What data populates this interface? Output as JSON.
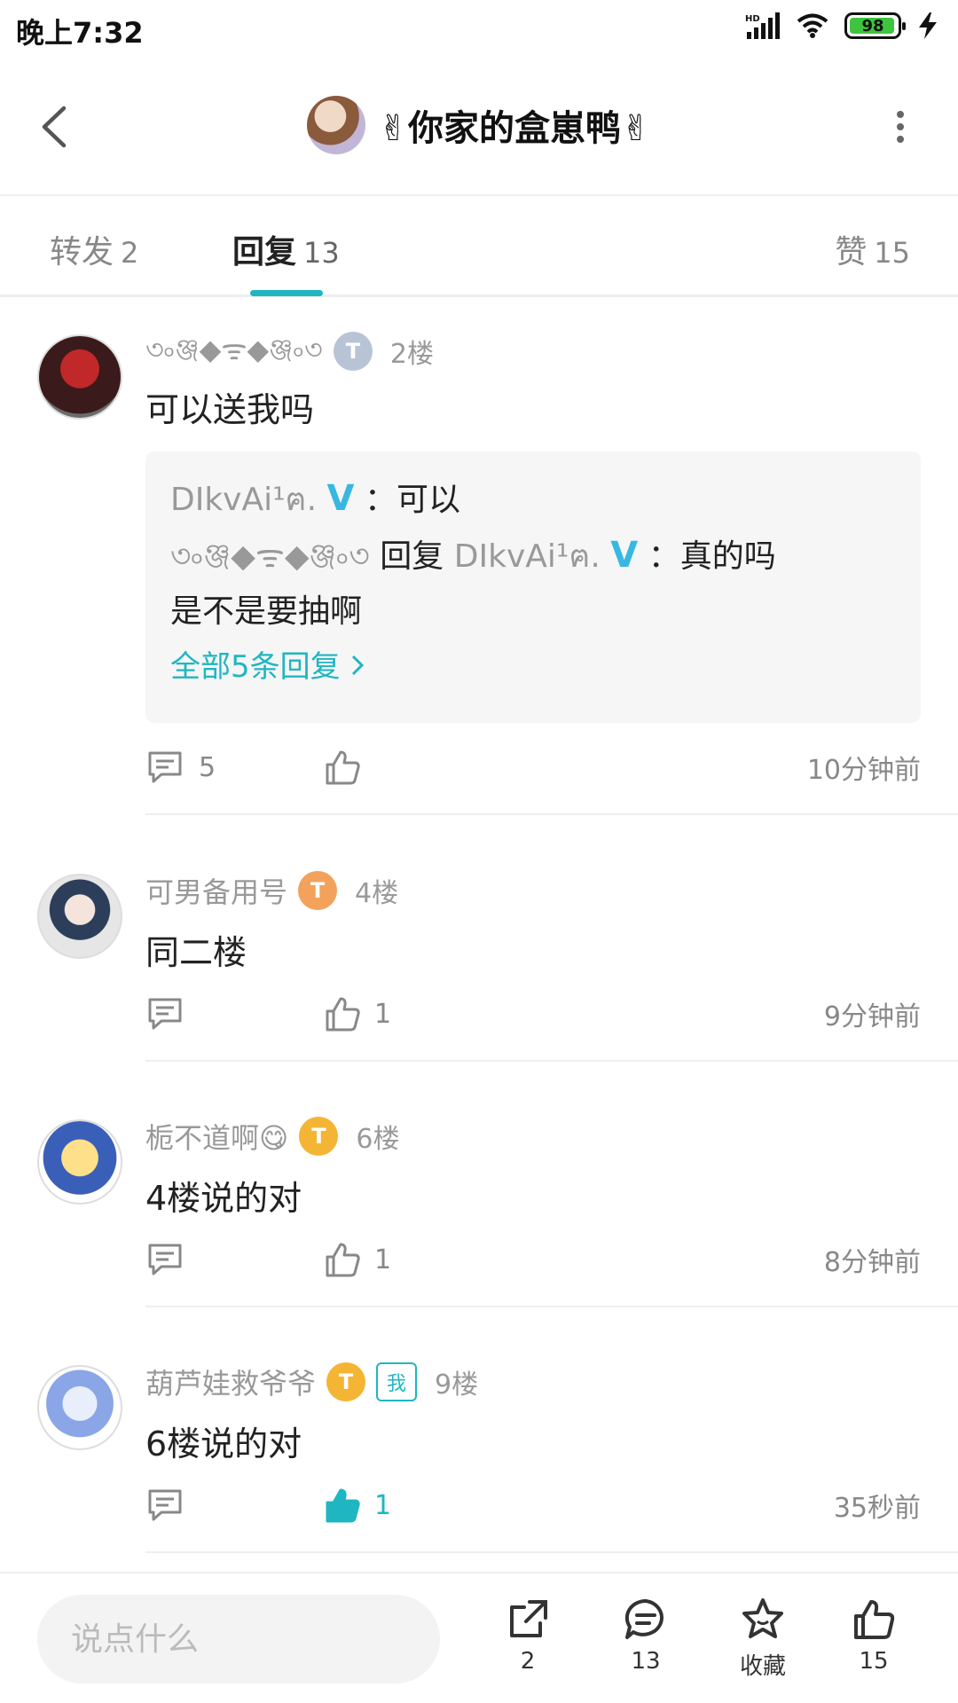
{
  "status_bar": {
    "time": "晚上7:32",
    "battery": "98",
    "network": "HD"
  },
  "header": {
    "title": "✌你家的盒崽鸭✌"
  },
  "tabs": [
    {
      "label": "转发",
      "count": "2"
    },
    {
      "label": "回复",
      "count": "13",
      "active": true
    },
    {
      "label": "赞",
      "count": "15"
    }
  ],
  "comments": [
    {
      "username": "৩৹ঞ্জ◆ᯤ◆ঞ্জ৹৩",
      "floor": "2楼",
      "text": "可以送我吗",
      "level": "T",
      "sub_replies": {
        "line1_user": "DIkvAi¹ฅ.",
        "line1_text": "：可以",
        "line2_user": "৩৹ঞ্জ◆ᯤ◆ঞ্জ৹৩",
        "line2_reply_word": "回复",
        "line2_target": "DIkvAi¹ฅ.",
        "line2_text": "：真的吗",
        "line3_text": "是不是要抽啊",
        "all_label": "全部5条回复",
        "v_mark": "V"
      },
      "reply_count": "5",
      "like_count": "",
      "time": "10分钟前"
    },
    {
      "username": "可男备用号",
      "floor": "4楼",
      "text": "同二楼",
      "level": "T",
      "reply_count": "",
      "like_count": "1",
      "time": "9分钟前"
    },
    {
      "username": "栀不道啊😋",
      "floor": "6楼",
      "text": "4楼说的对",
      "level": "T",
      "reply_count": "",
      "like_count": "1",
      "time": "8分钟前"
    },
    {
      "username": "葫芦娃救爷爷",
      "floor": "9楼",
      "text": "6楼说的对",
      "level": "T",
      "me_badge": "我",
      "reply_count": "",
      "like_count": "1",
      "liked": true,
      "time": "35秒前"
    }
  ],
  "bottom_bar": {
    "input_placeholder": "说点什么",
    "share_count": "2",
    "reply_count": "13",
    "favorite_label": "收藏",
    "like_count": "15"
  },
  "colors": {
    "accent": "#1fb6c2",
    "level_silver": "#b8c4d6",
    "level_orange": "#f2a25a",
    "level_gold": "#f4b534"
  }
}
